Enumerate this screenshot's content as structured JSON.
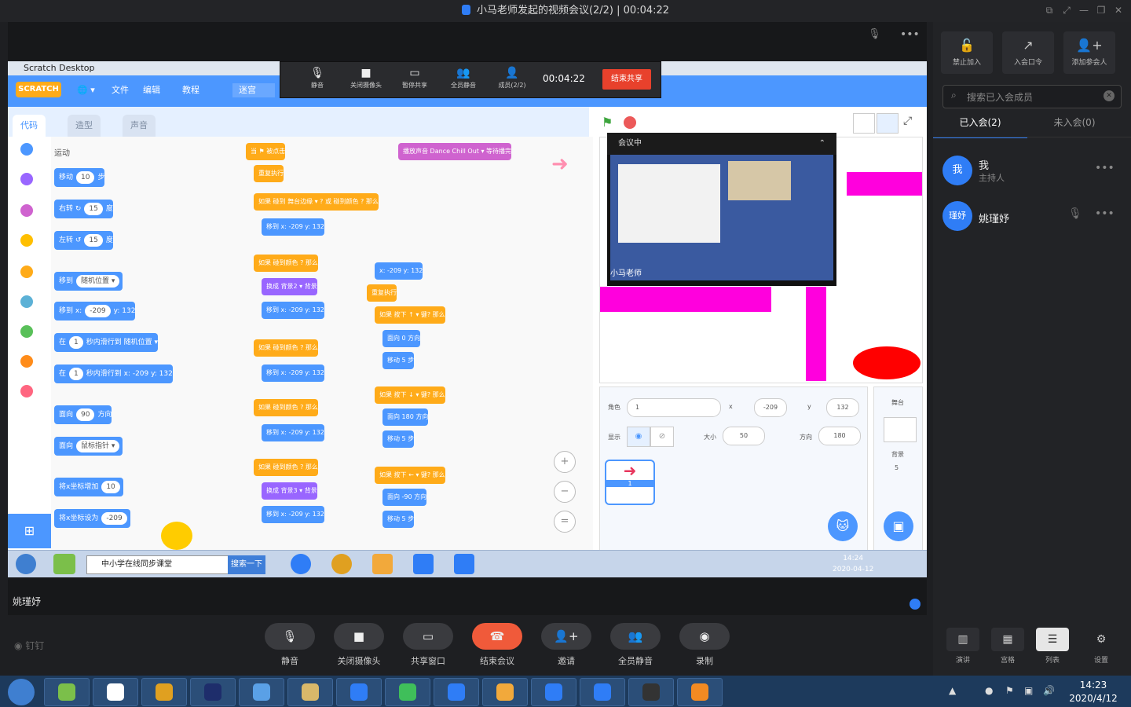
{
  "window": {
    "title": "小马老师发起的视频会议(2/2) | 00:04:22"
  },
  "shared_screen": {
    "app_title": "Scratch Desktop",
    "menu": [
      "文件",
      "编辑",
      "教程",
      "迷宫"
    ],
    "logo": "SCRATCH",
    "share_bar": {
      "items": [
        "静音",
        "关闭摄像头",
        "暂停共享",
        "全员静音",
        "成员(2/2)"
      ],
      "timer": "00:04:22",
      "end_label": "结束共享"
    },
    "tabs": [
      "代码",
      "造型",
      "声音"
    ],
    "categories": [
      {
        "label": "运动",
        "color": "#4c97ff"
      },
      {
        "label": "外观",
        "color": "#9966ff"
      },
      {
        "label": "声音",
        "color": "#cf63cf"
      },
      {
        "label": "事件",
        "color": "#ffbf00"
      },
      {
        "label": "控制",
        "color": "#ffab19"
      },
      {
        "label": "侦测",
        "color": "#5cb1d6"
      },
      {
        "label": "运算",
        "color": "#59c059"
      },
      {
        "label": "变量",
        "color": "#ff8c1a"
      },
      {
        "label": "自制积木",
        "color": "#ff6680"
      }
    ],
    "palette_heading": "运动",
    "palette_blocks": [
      {
        "text": "移动",
        "num": "10",
        "suffix": "步"
      },
      {
        "text": "右转 ↻",
        "num": "15",
        "suffix": "度"
      },
      {
        "text": "左转 ↺",
        "num": "15",
        "suffix": "度"
      },
      {
        "text": "移到",
        "num": "随机位置 ▾",
        "suffix": ""
      },
      {
        "text": "移到 x:",
        "num": "-209",
        "suffix": "y: 132"
      },
      {
        "text": "在",
        "num": "1",
        "suffix": "秒内滑行到 随机位置 ▾"
      },
      {
        "text": "在",
        "num": "1",
        "suffix": "秒内滑行到 x: -209 y: 132"
      },
      {
        "text": "面向",
        "num": "90",
        "suffix": "方向"
      },
      {
        "text": "面向",
        "num": "鼠标指针 ▾",
        "suffix": ""
      },
      {
        "text": "将x坐标增加",
        "num": "10",
        "suffix": ""
      },
      {
        "text": "将x坐标设为",
        "num": "-209",
        "suffix": ""
      }
    ],
    "code_blocks": [
      {
        "text": "当 ⚑ 被点击",
        "kind": "event"
      },
      {
        "text": "重复执行",
        "kind": "control"
      },
      {
        "text": "如果 碰到 舞台边缘 ▾ ? 或 碰到颜色 ? 那么",
        "kind": "control"
      },
      {
        "text": "移到 x: -209 y: 132",
        "kind": "motion"
      },
      {
        "text": "如果 碰到颜色 ? 那么",
        "kind": "control"
      },
      {
        "text": "换成 背景2 ▾ 背景",
        "kind": "looks"
      },
      {
        "text": "移到 x: -209 y: 132",
        "kind": "motion"
      },
      {
        "text": "如果 碰到颜色 ? 那么",
        "kind": "control"
      },
      {
        "text": "移到 x: -209 y: 132",
        "kind": "motion"
      },
      {
        "text": "如果 碰到颜色 ? 那么",
        "kind": "control"
      },
      {
        "text": "移到 x: -209 y: 132",
        "kind": "motion"
      },
      {
        "text": "如果 碰到颜色 ? 那么",
        "kind": "control"
      },
      {
        "text": "换成 背景3 ▾ 背景",
        "kind": "looks"
      },
      {
        "text": "移到 x: -209 y: 132",
        "kind": "motion"
      }
    ],
    "code_blocks_right": [
      {
        "text": "播放声音 Dance Chill Out ▾ 等待播完",
        "kind": "sound"
      },
      {
        "text": "x: -209 y: 132",
        "kind": "motion"
      },
      {
        "text": "重复执行",
        "kind": "control"
      },
      {
        "text": "如果 按下 ↑ ▾ 键? 那么",
        "kind": "control"
      },
      {
        "text": "面向 0 方向",
        "kind": "motion"
      },
      {
        "text": "移动 5 步",
        "kind": "motion"
      },
      {
        "text": "如果 按下 ↓ ▾ 键? 那么",
        "kind": "control"
      },
      {
        "text": "面向 180 方向",
        "kind": "motion"
      },
      {
        "text": "移动 5 步",
        "kind": "motion"
      },
      {
        "text": "如果 按下 ← ▾ 键? 那么",
        "kind": "control"
      },
      {
        "text": "面向 -90 方向",
        "kind": "motion"
      },
      {
        "text": "移动 5 步",
        "kind": "motion"
      }
    ],
    "pip": {
      "heading": "会议中",
      "presenter": "小马老师"
    },
    "sprite": {
      "role_label": "角色",
      "role_value": "1",
      "x_label": "x",
      "x_value": "-209",
      "y_label": "y",
      "y_value": "132",
      "show_label": "显示",
      "size_label": "大小",
      "size_value": "50",
      "dir_label": "方向",
      "dir_value": "180",
      "thumb_label": "1"
    },
    "backdrop": {
      "label": "舞台",
      "sub_label": "背景",
      "count": "5"
    },
    "inner_taskbar": {
      "search_text": "中小学在线同步课堂",
      "search_btn": "搜索一下",
      "time": "14:24",
      "date": "2020-04-12"
    }
  },
  "speaker_name": "姚瑾妤",
  "sidebar": {
    "buttons": [
      {
        "label": "禁止加入",
        "icon": "lock-icon"
      },
      {
        "label": "入会口令",
        "icon": "share-icon"
      },
      {
        "label": "添加参会人",
        "icon": "add-user-icon"
      }
    ],
    "search_placeholder": "搜索已入会成员",
    "tab_joined": "已入会(2)",
    "tab_not_joined": "未入会(0)",
    "members": [
      {
        "avatar": "我",
        "name": "我",
        "role": "主持人"
      },
      {
        "avatar": "瑾妤",
        "name": "姚瑾妤",
        "role": ""
      }
    ]
  },
  "toolbar": {
    "items": [
      {
        "label": "静音",
        "icon": "mic-icon"
      },
      {
        "label": "关闭摄像头",
        "icon": "camera-icon"
      },
      {
        "label": "共享窗口",
        "icon": "screen-icon"
      },
      {
        "label": "结束会议",
        "icon": "hangup-icon"
      },
      {
        "label": "邀请",
        "icon": "invite-icon"
      },
      {
        "label": "全员静音",
        "icon": "mute-all-icon"
      },
      {
        "label": "录制",
        "icon": "record-icon"
      }
    ],
    "layouts": [
      "演讲",
      "宫格",
      "列表"
    ],
    "settings_label": "设置",
    "brand": "钉钉"
  },
  "taskbar": {
    "time": "14:23",
    "date": "2020/4/12",
    "apps": [
      "swirl",
      "baidu-cloud",
      "chrome",
      "Ps",
      "cloud",
      "folder",
      "W",
      "wechat",
      "bluetooth",
      "book",
      "plane",
      "phone",
      "circle",
      "video"
    ]
  }
}
